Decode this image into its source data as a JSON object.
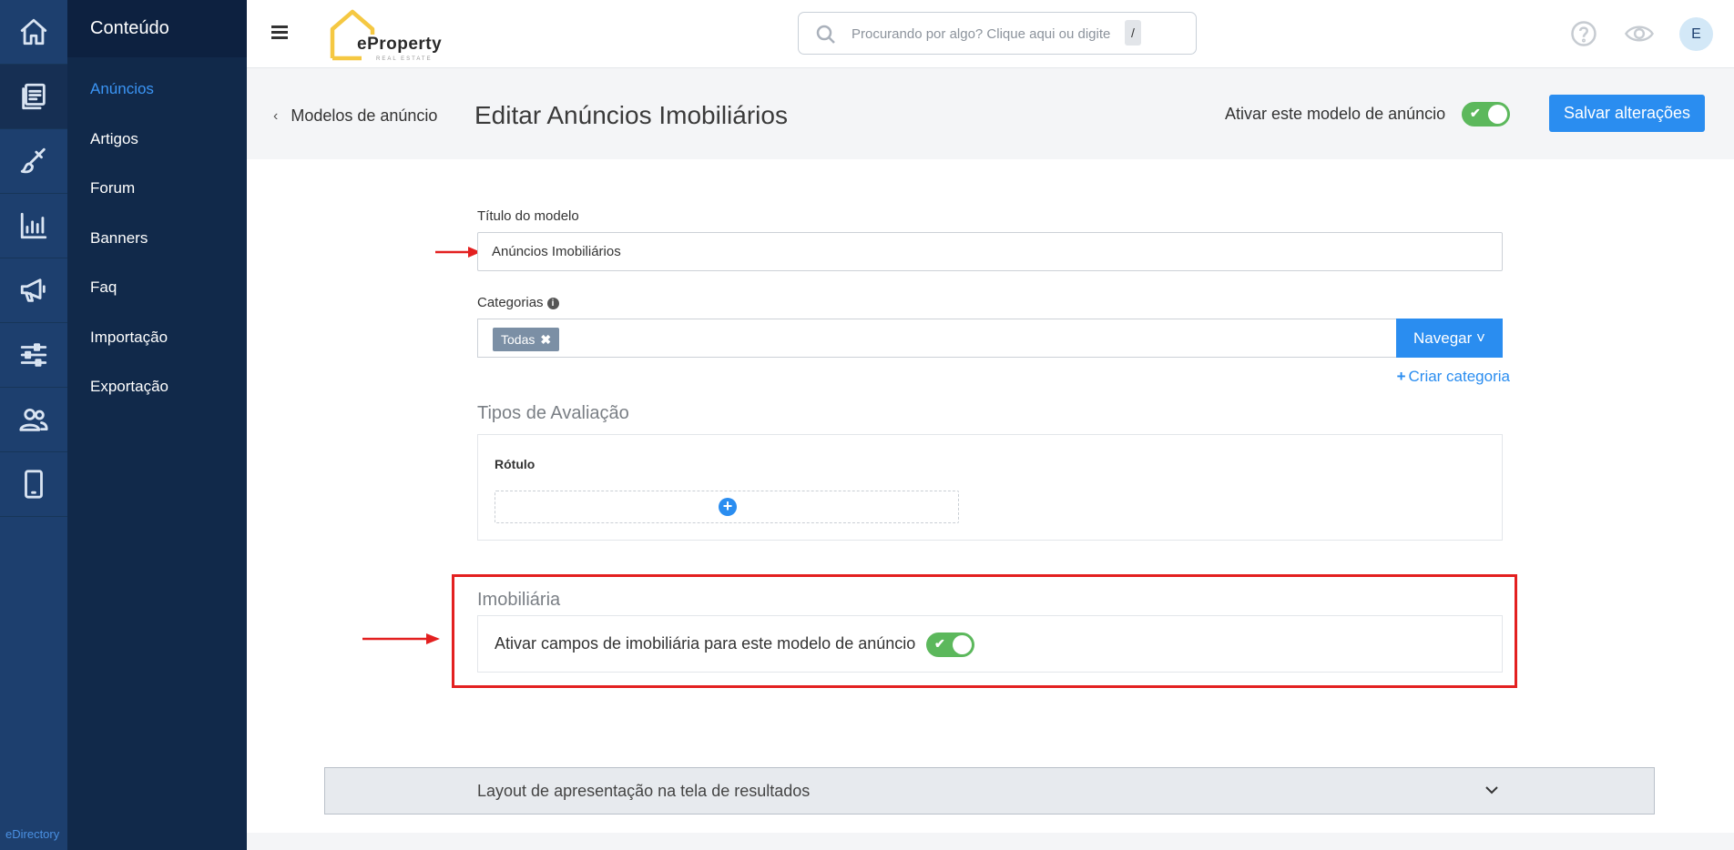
{
  "sidebar": {
    "icons": [
      "home-icon",
      "documents-icon",
      "brush-icon",
      "chart-icon",
      "megaphone-icon",
      "sliders-icon",
      "users-icon",
      "mobile-icon"
    ],
    "footer": "eDirectory"
  },
  "subnav": {
    "title": "Conteúdo",
    "items": [
      "Anúncios",
      "Artigos",
      "Forum",
      "Banners",
      "Faq",
      "Importação",
      "Exportação"
    ]
  },
  "topbar": {
    "logo_text": "eProperty",
    "logo_sub": "REAL ESTATE",
    "search_placeholder": "Procurando por algo? Clique aqui ou digite",
    "search_key": "/",
    "avatar": "E"
  },
  "header": {
    "back_label": "Modelos de anúncio",
    "title": "Editar Anúncios Imobiliários",
    "activate_label": "Ativar este modelo de anúncio",
    "activate_on": true,
    "save_label": "Salvar alterações"
  },
  "form": {
    "title_label": "Título do modelo",
    "title_value": "Anúncios Imobiliários",
    "categories_label": "Categorias",
    "category_tag": "Todas",
    "browse_label": "Navegar",
    "create_category": "Criar categoria",
    "review_section": "Tipos de Avaliação",
    "rotulo_label": "Rótulo",
    "real_estate_section": "Imobiliária",
    "real_estate_toggle_label": "Ativar campos de imobiliária para este modelo de anúncio",
    "real_estate_on": true,
    "accordion_label": "Layout de apresentação na tela de resultados"
  },
  "colors": {
    "primary": "#2a8df0",
    "rail": "#1d3f6e",
    "subnav": "#11294a",
    "toggle_on": "#5cb85c",
    "highlight": "#e32020"
  }
}
